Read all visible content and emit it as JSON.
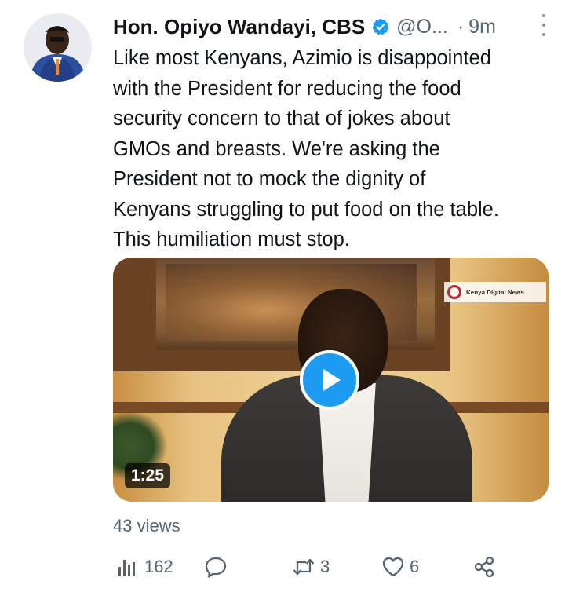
{
  "author": {
    "name": "Hon. Opiyo Wandayi, CBS",
    "handle": "@O...",
    "separator": "·",
    "time": "9m",
    "verified": true,
    "avatar_icon": "profile-photo"
  },
  "tweet": {
    "text": "Like most Kenyans, Azimio is disappointed\nwith the President for reducing the food\nsecurity concern to that of jokes about\nGMOs and breasts. We're asking the\nPresident not to mock the dignity of\nKenyans struggling to put food on the table.\nThis humiliation must stop."
  },
  "media": {
    "duration": "1:25",
    "watermark": "Kenya Digital News",
    "play_icon": "play-icon"
  },
  "views": "43 views",
  "actions": {
    "views_count": "162",
    "reply_count": "",
    "retweet_count": "3",
    "like_count": "6"
  },
  "colors": {
    "text": "#0f1419",
    "secondary": "#536471",
    "accent": "#1d9bf0"
  }
}
